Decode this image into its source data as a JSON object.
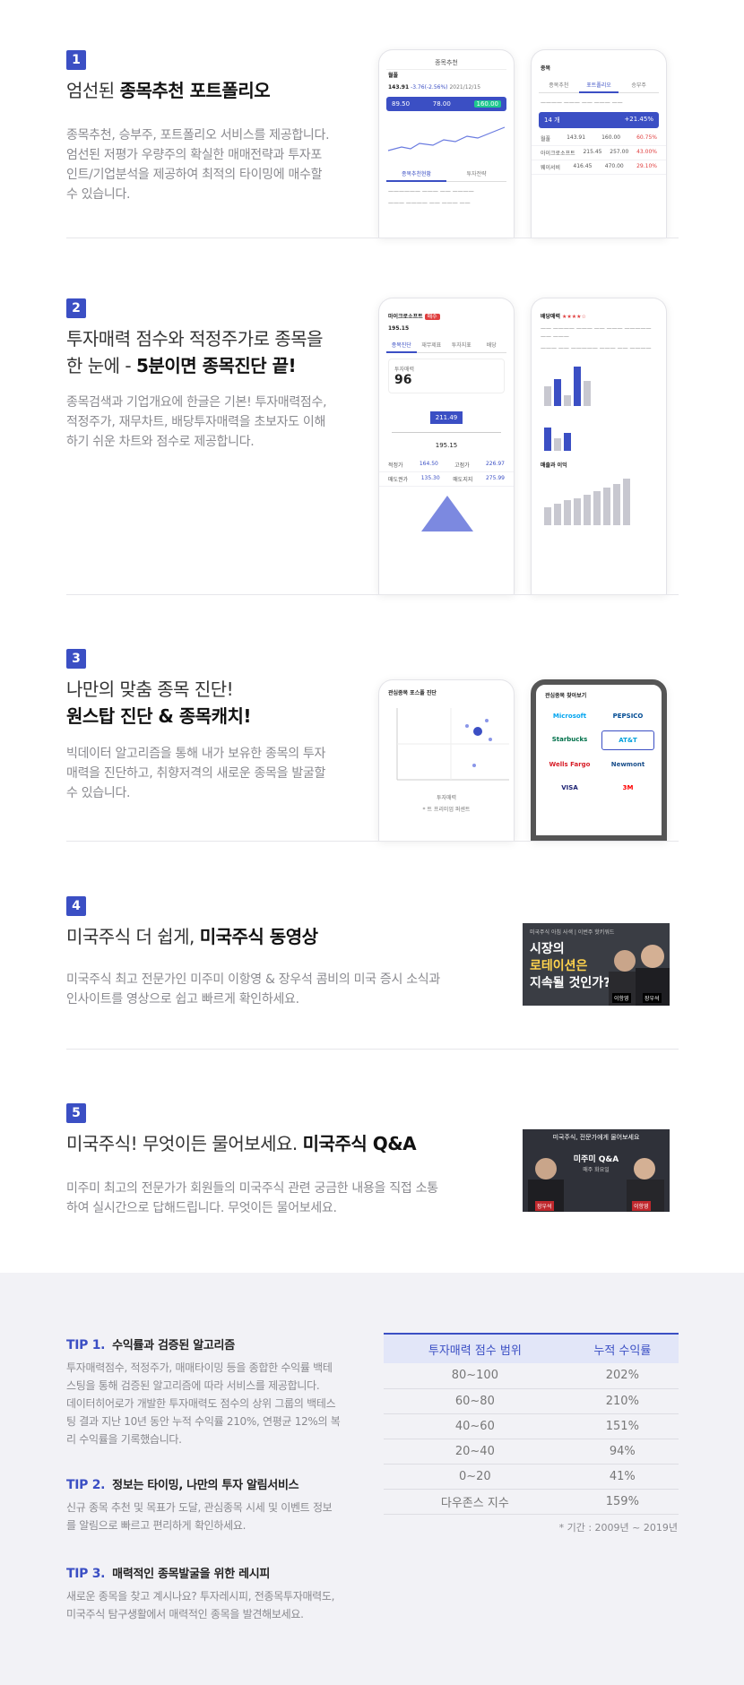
{
  "sections": [
    {
      "num": "1",
      "title_pre": "엄선된 ",
      "title_bold": "종목추천 포트폴리오",
      "title2_pre": "",
      "title2_bold": "",
      "desc": [
        "종목추천, 승부주, 포트폴리오 서비스를 제공합니다.",
        "엄선된 저평가 우량주의 확실한 매매전략과 투자포",
        "인트/기업분석을 제공하여 최적의 타이밍에 매수할",
        "수 있습니다."
      ]
    },
    {
      "num": "2",
      "title_pre": "투자매력 점수와 적정주가로 종목을",
      "title_bold": "",
      "title2_pre": "한 눈에 - ",
      "title2_bold": "5분이면 종목진단 끝!",
      "desc": [
        "종목검색과 기업개요에 한글은 기본! 투자매력점수,",
        "적정주가, 재무차트, 배당투자매력을 초보자도 이해",
        "하기 쉬운 차트와 점수로 제공합니다."
      ]
    },
    {
      "num": "3",
      "title_pre": "나만의 맞춤 종목 진단!",
      "title_bold": "",
      "title2_pre": "",
      "title2_bold": "원스탑 진단 & 종목캐치!",
      "desc": [
        "빅데이터 알고리즘을 통해 내가 보유한 종목의 투자",
        "매력을 진단하고, 취향저격의 새로운 종목을 발굴할",
        "수 있습니다."
      ]
    },
    {
      "num": "4",
      "title_pre": "미국주식 더 쉽게, ",
      "title_bold": "미국주식 동영상",
      "title2_pre": "",
      "title2_bold": "",
      "desc": [
        "미국주식 최고 전문가인 미주미 이항영 & 장우석 콤비의 미국 증시 소식과",
        "인사이트를 영상으로 쉽고 빠르게 확인하세요."
      ]
    },
    {
      "num": "5",
      "title_pre": "미국주식! 무엇이든 물어보세요. ",
      "title_bold": "미국주식 Q&A",
      "title2_pre": "",
      "title2_bold": "",
      "desc": [
        "미주미 최고의 전문가가 회원들의 미국주식 관련 궁금한 내용을 직접 소통",
        "하여 실시간으로 답해드립니다. 무엇이든 물어보세요."
      ]
    }
  ],
  "phones": {
    "p1a": {
      "header": "종목추천",
      "stock": "월풀",
      "price": "143.91",
      "change": "-3.76(-2.56%)",
      "date": "2021/12/15",
      "box": [
        "89.50",
        "78.00",
        "160.00"
      ],
      "tab1": "종목추천현황",
      "tab2": "투자전략"
    },
    "p1b": {
      "header": "종목",
      "tabs": [
        "종목추천",
        "포트폴리오",
        "승부주"
      ],
      "box": [
        "14 개",
        "+21.45%"
      ],
      "rows": [
        [
          "월풀",
          "143.91",
          "160.00",
          "60.75%"
        ],
        [
          "아이크로소프트",
          "215.45",
          "257.00",
          "43.00%"
        ],
        [
          "웨이서비",
          "416.45",
          "470.00",
          "29.10%"
        ]
      ]
    },
    "p2a": {
      "stock": "마이크로소프트",
      "price": "195.15",
      "score": "96",
      "fair": "211.49",
      "cur": "195.15"
    },
    "p2b": {
      "label": "배당매력",
      "chart_title": "매출과 이익"
    },
    "p3a": {
      "title": "관심종목 포스폴 진단",
      "axis": "투자매력",
      "legend": "* 트 프리미엄 퍼센트"
    },
    "p3b": {
      "title": "관심종목 찾아보기",
      "brands": [
        "Microsoft",
        "PEPSICO",
        "Starbucks",
        "AT&T",
        "Wells Fargo",
        "Newmont",
        "VISA",
        "3M"
      ]
    }
  },
  "thumbs": {
    "video": {
      "top": "미국주식 아침 사색 | 이번주 핫키워드",
      "l1": "시장의",
      "l2": "로테이션은",
      "l3": "지속될 것인가?",
      "n1": "이항영",
      "n2": "장우석"
    },
    "qa": {
      "top": "미국주식, 전문가에게 물어보세요",
      "main": "미주미 Q&A",
      "sub": "매주 화요일",
      "n1": "장우석",
      "n2": "이항영"
    }
  },
  "tips": [
    {
      "num": "TIP 1.",
      "title": "수익률과 검증된 알고리즘",
      "body": [
        "투자매력점수, 적정주가, 매매타이밍 등을 종합한 수익률 백테",
        "스팅을 통해 검증된 알고리즘에 따라 서비스를 제공합니다.",
        "데이터히어로가 개발한 투자매력도 점수의 상위 그룹의 백테스",
        "팅 결과 지난 10년 동안 누적 수익률 210%, 연평균 12%의 복",
        "리 수익률을 기록했습니다."
      ]
    },
    {
      "num": "TIP 2.",
      "title": "정보는 타이밍, 나만의 투자 알림서비스",
      "body": [
        "신규 종목 추천 및 목표가 도달, 관심종목 시세 및 이벤트 정보",
        "를 알림으로 빠르고 편리하게 확인하세요."
      ]
    },
    {
      "num": "TIP 3.",
      "title": "매력적인 종목발굴을 위한 레시피",
      "body": [
        "새로운 종목을 찾고 계시나요? 투자레시피, 전종목투자매력도,",
        "미국주식 탐구생활에서 매력적인 종목을 발견해보세요."
      ]
    }
  ],
  "table": {
    "headers": [
      "투자매력 점수 범위",
      "누적 수익률"
    ],
    "rows": [
      [
        "80~100",
        "202%"
      ],
      [
        "60~80",
        "210%"
      ],
      [
        "40~60",
        "151%"
      ],
      [
        "20~40",
        "94%"
      ],
      [
        "0~20",
        "41%"
      ],
      [
        "다우존스 지수",
        "159%"
      ]
    ],
    "note": "* 기간 : 2009년 ~ 2019년"
  }
}
